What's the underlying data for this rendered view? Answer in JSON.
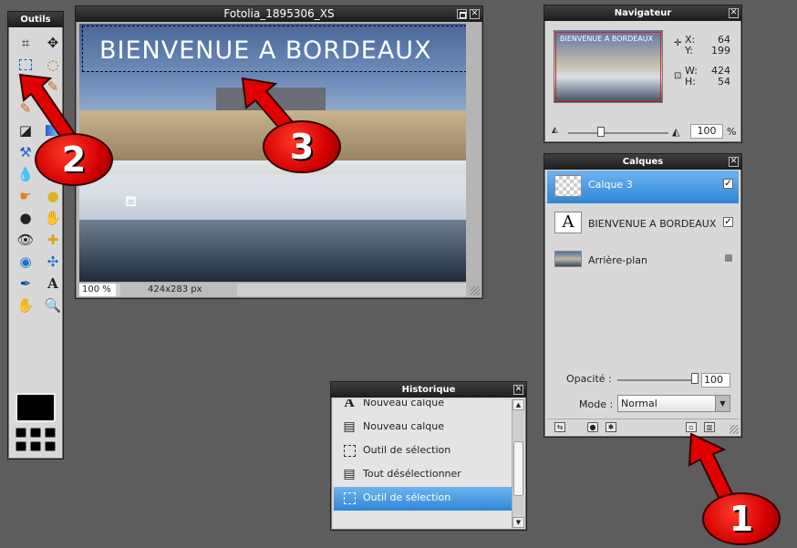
{
  "tools_panel": {
    "title": "Outils"
  },
  "image_window": {
    "title": "Fotolia_1895306_XS",
    "banner_text": "BIENVENUE A BORDEAUX",
    "zoom": "100 %",
    "dimensions": "424x283 px"
  },
  "navigator": {
    "title": "Navigateur",
    "thumb_text": "BIENVENUE A BORDEAUX",
    "x_label": "X:",
    "x_value": "64",
    "y_label": "Y:",
    "y_value": "199",
    "w_label": "W:",
    "w_value": "424",
    "h_label": "H:",
    "h_value": "54",
    "zoom_value": "100",
    "zoom_unit": "%"
  },
  "layers": {
    "title": "Calques",
    "items": [
      {
        "name": "Calque 3",
        "selected": true,
        "checked": true
      },
      {
        "name": "BIENVENUE A BORDEAUX",
        "selected": false,
        "checked": true
      },
      {
        "name": "Arrière-plan",
        "selected": false,
        "locked": true
      }
    ],
    "opacity_label": "Opacité :",
    "opacity_value": "100",
    "mode_label": "Mode :",
    "mode_value": "Normal"
  },
  "history": {
    "title": "Historique",
    "items": [
      {
        "label": "Nouveau calque",
        "icon": "text-icon"
      },
      {
        "label": "Nouveau calque",
        "icon": "new-layer-icon"
      },
      {
        "label": "Outil de sélection",
        "icon": "marquee-icon"
      },
      {
        "label": "Tout désélectionner",
        "icon": "deselect-icon"
      },
      {
        "label": "Outil de sélection",
        "icon": "marquee-icon",
        "selected": true
      }
    ]
  },
  "annotations": {
    "badge_1": "1",
    "badge_2": "2",
    "badge_3": "3",
    "color": "#e00000"
  }
}
